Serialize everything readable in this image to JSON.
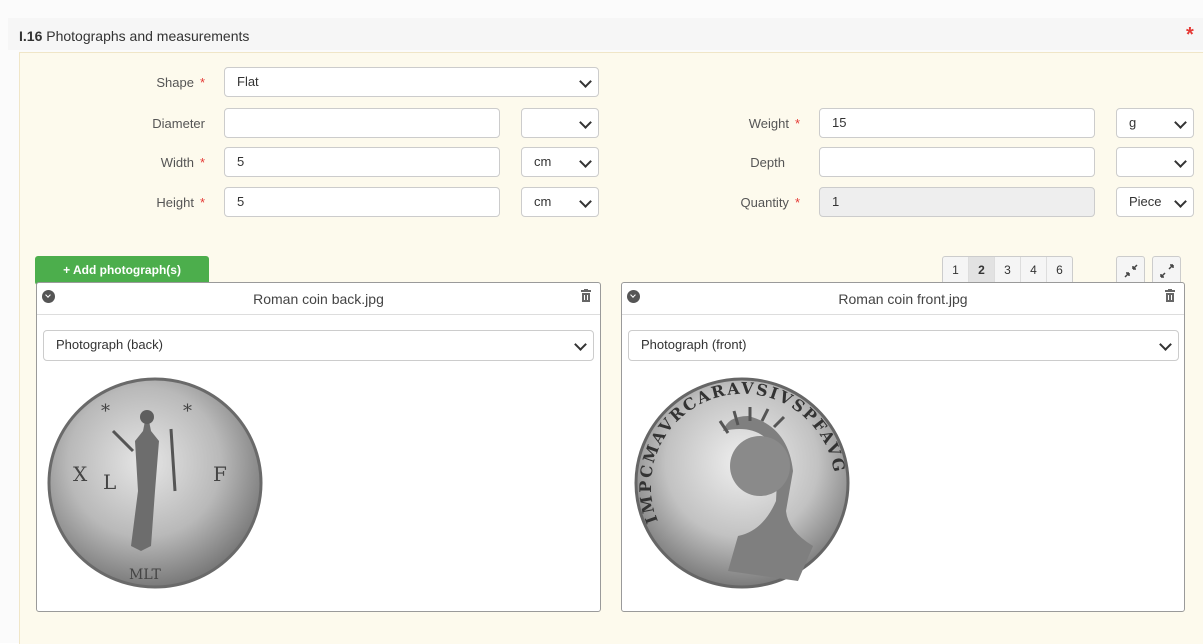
{
  "section": {
    "number": "I.16",
    "title": "Photographs and measurements",
    "required_mark": "*"
  },
  "form": {
    "shape": {
      "label": "Shape",
      "required": "*",
      "value": "Flat"
    },
    "diameter": {
      "label": "Diameter",
      "value": "",
      "unit": ""
    },
    "width": {
      "label": "Width",
      "required": "*",
      "value": "5",
      "unit": "cm"
    },
    "height": {
      "label": "Height",
      "required": "*",
      "value": "5",
      "unit": "cm"
    },
    "weight": {
      "label": "Weight",
      "required": "*",
      "value": "15",
      "unit": "g"
    },
    "depth": {
      "label": "Depth",
      "value": "",
      "unit": ""
    },
    "quantity": {
      "label": "Quantity",
      "required": "*",
      "value": "1",
      "unit": "Piece"
    }
  },
  "toolbar": {
    "add_label": "+ Add photograph(s)",
    "pages": [
      "1",
      "2",
      "3",
      "4",
      "6"
    ],
    "active_page": "2"
  },
  "photos": [
    {
      "filename": "Roman coin back.jpg",
      "type": "Photograph (back)",
      "legend": [
        "*",
        "*",
        "X",
        "L",
        "F",
        "MLT"
      ]
    },
    {
      "filename": "Roman coin front.jpg",
      "type": "Photograph (front)",
      "legend": "IMPCMAVRCARAVSIVSPFAVG"
    }
  ],
  "colors": {
    "accent_green": "#4cae4c",
    "required_red": "#e53935",
    "panel_bg": "#fdfaed"
  }
}
